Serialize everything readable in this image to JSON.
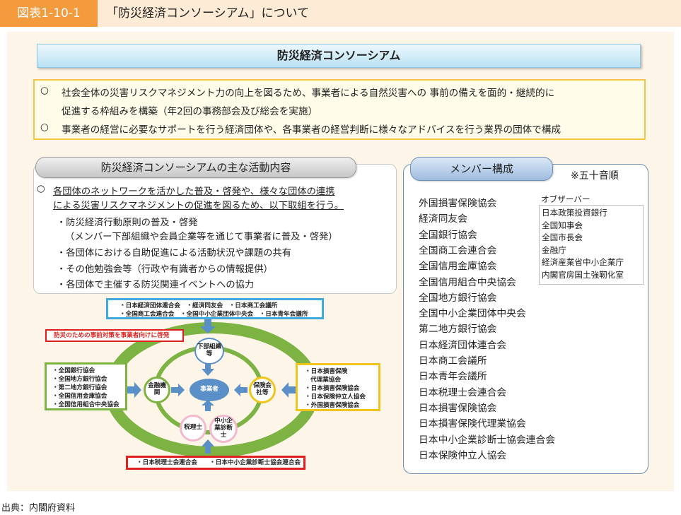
{
  "figure": {
    "label": "図表1-10-1",
    "title": "「防災経済コンソーシアム」について"
  },
  "consortium_title": "防災経済コンソーシアム",
  "summary": {
    "marker": "○",
    "lines": [
      "社会全体の災害リスクマネジメント力の向上を図るため、事業者による自然災害への 事前の備えを面的・継続的に",
      "促進する枠組みを構築（年2回の事務部会及び総会を実施）",
      "事業者の経営に必要なサポートを行う経済団体や、各事業者の経営判断に様々なアドバイスを行う業界の団体で構成"
    ]
  },
  "activities": {
    "heading": "防災経済コンソーシアムの主な活動内容",
    "marker": "○",
    "intro": [
      "各団体のネットワークを活かした普及・啓発や、様々な団体の連携",
      "による災害リスクマネジメントの促進を図るため、以下取組を行う。"
    ],
    "items": [
      "・防災経済行動原則の普及・啓発",
      "（メンバー下部組織や会員企業等を通じて事業者に普及・啓発）",
      "・各団体における自助促進による活動状況や課題の共有",
      "・その他勉強会等（行政や有識者からの情報提供）",
      "・各団体で主催する防災関連イベントへの協力"
    ]
  },
  "diagram": {
    "top_box": [
      "・日本経済団体連合会　・経済同友会　・日本商工会議所",
      "・全国商工会連合会　・全国中小企業団体中央会　・日本青年会議所"
    ],
    "red_note": "防災のための事前対策を事業者向けに啓発",
    "left_box": [
      "・全国銀行協会",
      "・全国地方銀行協会",
      "・第二地方銀行協会",
      "・全国信用金庫協会",
      "・全国信用組合中央協会"
    ],
    "right_box": [
      "・日本損害保険",
      "代理業協会",
      "・日本損害保険協会",
      "・日本保険仲立人協会",
      "・外国損害保険協会"
    ],
    "bottom_box": "・日本税理士会連合会　　・日本中小企業診断士協会連合会",
    "nodes": {
      "lower_org": "下部組織等",
      "business": "事業者",
      "financial": "金融機関",
      "insurance": "保険会社等",
      "tax": "税理士",
      "consultant": "中小企業診断士"
    }
  },
  "members": {
    "heading": "メンバー構成",
    "note": "※五十音順",
    "list": [
      "外国損害保険協会",
      "経済同友会",
      "全国銀行協会",
      "全国商工会連合会",
      "全国信用金庫協会",
      "全国信用組合中央協会",
      "全国地方銀行協会",
      "全国中小企業団体中央会",
      "第二地方銀行協会",
      "日本経済団体連合会",
      "日本商工会議所",
      "日本青年会議所",
      "日本税理士会連合会",
      "日本損害保険協会",
      "日本損害保険代理業協会",
      "日本中小企業診断士協会連合会",
      "日本保険仲立人協会"
    ],
    "observer_label": "オブザーバー",
    "observers": [
      "日本政策投資銀行",
      "全国知事会",
      "全国市長会",
      "金融庁",
      "経済産業省中小企業庁",
      "内閣官房国土強靭化室"
    ]
  },
  "source": "出典：内閣府資料",
  "colors": {
    "accent_orange": "#f29a3c",
    "ring_green": "#7cb342",
    "summary_border": "#f5c642",
    "top_box_border": "#3fa9e0",
    "right_box_border": "#f2c51c",
    "red": "#e02020"
  }
}
